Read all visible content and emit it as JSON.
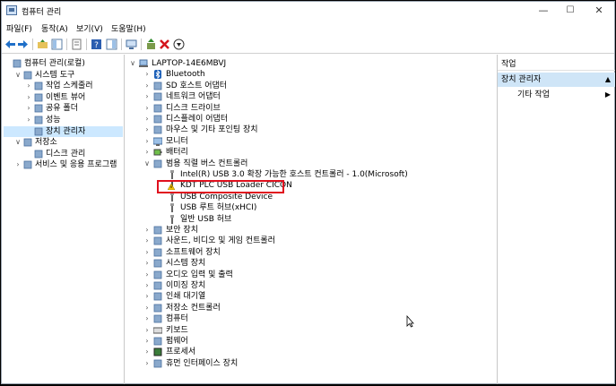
{
  "window": {
    "title": "컴퓨터 관리",
    "minimize": "—",
    "maximize": "☐",
    "close": "✕"
  },
  "menu": [
    "파일(F)",
    "동작(A)",
    "보기(V)",
    "도움말(H)"
  ],
  "left_tree": [
    {
      "label": "컴퓨터 관리(로컬)",
      "level": 0,
      "arrow": "",
      "icon": "computer-management-icon",
      "selected": false
    },
    {
      "label": "시스템 도구",
      "level": 1,
      "arrow": "∨",
      "icon": "system-tools-icon",
      "selected": false
    },
    {
      "label": "작업 스케줄러",
      "level": 2,
      "arrow": "›",
      "icon": "task-scheduler-icon",
      "selected": false
    },
    {
      "label": "이벤트 뷰어",
      "level": 2,
      "arrow": "›",
      "icon": "event-viewer-icon",
      "selected": false
    },
    {
      "label": "공유 폴더",
      "level": 2,
      "arrow": "›",
      "icon": "shared-folder-icon",
      "selected": false
    },
    {
      "label": "성능",
      "level": 2,
      "arrow": "›",
      "icon": "performance-icon",
      "selected": false
    },
    {
      "label": "장치 관리자",
      "level": 2,
      "arrow": "",
      "icon": "device-manager-icon",
      "selected": true
    },
    {
      "label": "저장소",
      "level": 1,
      "arrow": "∨",
      "icon": "storage-icon",
      "selected": false
    },
    {
      "label": "디스크 관리",
      "level": 2,
      "arrow": "",
      "icon": "disk-management-icon",
      "selected": false
    },
    {
      "label": "서비스 및 응용 프로그램",
      "level": 1,
      "arrow": "›",
      "icon": "services-icon",
      "selected": false
    }
  ],
  "device_tree": {
    "root": {
      "label": "LAPTOP-14E6MBVJ",
      "arrow": "∨",
      "icon": "laptop-icon"
    },
    "items": [
      {
        "label": "Bluetooth",
        "level": 1,
        "arrow": "›",
        "icon": "bluetooth-icon"
      },
      {
        "label": "SD 호스트 어댑터",
        "level": 1,
        "arrow": "›",
        "icon": "sd-host-icon"
      },
      {
        "label": "네트워크 어댑터",
        "level": 1,
        "arrow": "›",
        "icon": "network-adapter-icon"
      },
      {
        "label": "디스크 드라이브",
        "level": 1,
        "arrow": "›",
        "icon": "disk-drive-icon"
      },
      {
        "label": "디스플레이 어댑터",
        "level": 1,
        "arrow": "›",
        "icon": "display-adapter-icon"
      },
      {
        "label": "마우스 및 기타 포인팅 장치",
        "level": 1,
        "arrow": "›",
        "icon": "mouse-icon"
      },
      {
        "label": "모니터",
        "level": 1,
        "arrow": "›",
        "icon": "monitor-icon"
      },
      {
        "label": "배터리",
        "level": 1,
        "arrow": "›",
        "icon": "battery-icon"
      },
      {
        "label": "범용 직렬 버스 컨트롤러",
        "level": 1,
        "arrow": "∨",
        "icon": "usb-controller-icon"
      },
      {
        "label": "Intel(R) USB 3.0 확장 가능한 호스트 컨트롤러 - 1.0(Microsoft)",
        "level": 2,
        "arrow": "",
        "icon": "usb-device-icon"
      },
      {
        "label": "KDT PLC USB Loader CICON",
        "level": 2,
        "arrow": "",
        "icon": "usb-warning-icon"
      },
      {
        "label": "USB Composite Device",
        "level": 2,
        "arrow": "",
        "icon": "usb-device-icon"
      },
      {
        "label": "USB 루트 허브(xHCI)",
        "level": 2,
        "arrow": "",
        "icon": "usb-device-icon"
      },
      {
        "label": "일반 USB 허브",
        "level": 2,
        "arrow": "",
        "icon": "usb-device-icon"
      },
      {
        "label": "보안 장치",
        "level": 1,
        "arrow": "›",
        "icon": "security-device-icon"
      },
      {
        "label": "사운드, 비디오 및 게임 컨트롤러",
        "level": 1,
        "arrow": "›",
        "icon": "sound-icon"
      },
      {
        "label": "소프트웨어 장치",
        "level": 1,
        "arrow": "›",
        "icon": "software-device-icon"
      },
      {
        "label": "시스템 장치",
        "level": 1,
        "arrow": "›",
        "icon": "system-device-icon"
      },
      {
        "label": "오디오 입력 및 출력",
        "level": 1,
        "arrow": "›",
        "icon": "audio-io-icon"
      },
      {
        "label": "이미징 장치",
        "level": 1,
        "arrow": "›",
        "icon": "imaging-device-icon"
      },
      {
        "label": "인쇄 대기열",
        "level": 1,
        "arrow": "›",
        "icon": "print-queue-icon"
      },
      {
        "label": "저장소 컨트롤러",
        "level": 1,
        "arrow": "›",
        "icon": "storage-controller-icon"
      },
      {
        "label": "컴퓨터",
        "level": 1,
        "arrow": "›",
        "icon": "computer-icon"
      },
      {
        "label": "키보드",
        "level": 1,
        "arrow": "›",
        "icon": "keyboard-icon"
      },
      {
        "label": "펌웨어",
        "level": 1,
        "arrow": "›",
        "icon": "firmware-icon"
      },
      {
        "label": "프로세서",
        "level": 1,
        "arrow": "›",
        "icon": "processor-icon"
      },
      {
        "label": "휴먼 인터페이스 장치",
        "level": 1,
        "arrow": "›",
        "icon": "hid-icon"
      }
    ]
  },
  "actions": {
    "header": "작업",
    "selected": "장치 관리자",
    "sub": "기타 작업"
  },
  "colors": {
    "selection": "#cce8ff",
    "highlight_box": "#e0101e",
    "action_selected": "#cfe5f7"
  }
}
